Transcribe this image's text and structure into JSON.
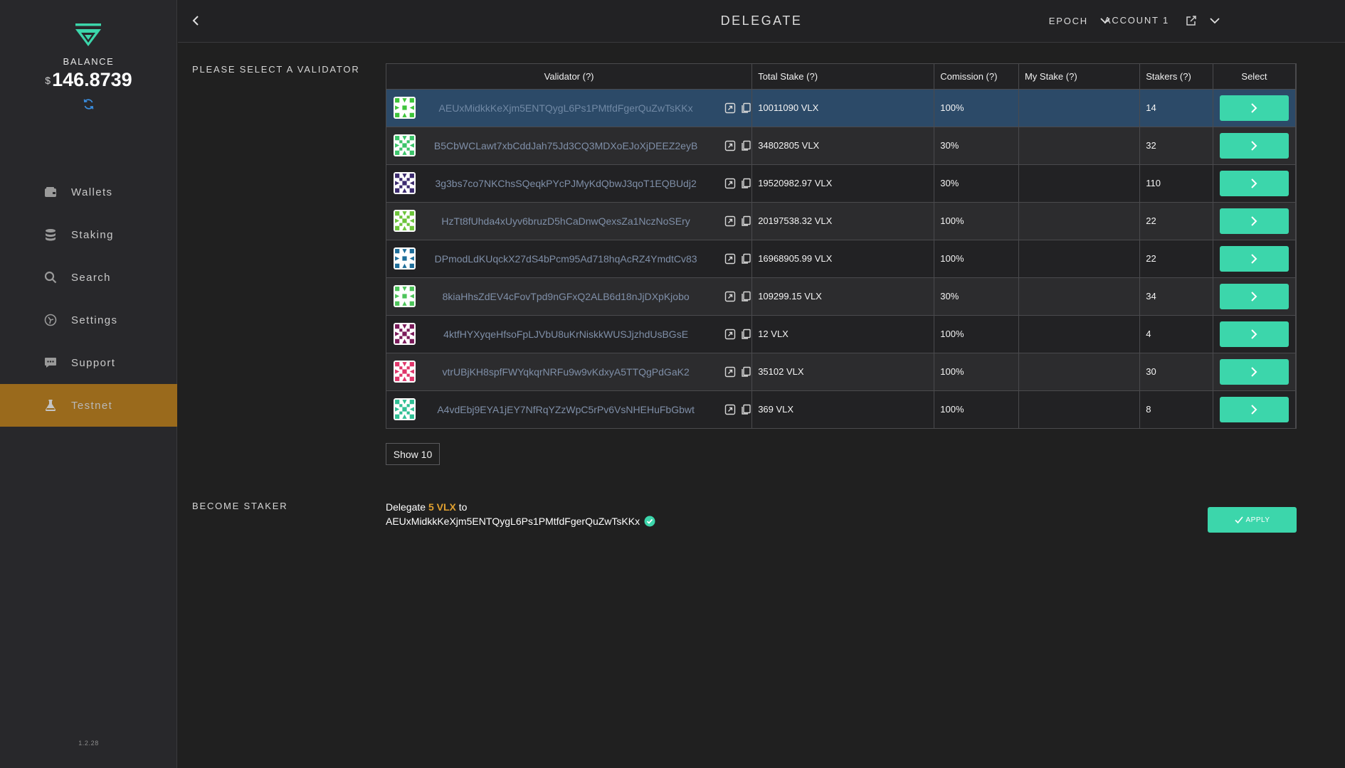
{
  "sidebar": {
    "balance_label": "BALANCE",
    "currency_symbol": "$",
    "balance_value": "146.8739",
    "nav": [
      {
        "label": "Wallets",
        "icon": "wallet-icon"
      },
      {
        "label": "Staking",
        "icon": "database-icon"
      },
      {
        "label": "Search",
        "icon": "search-icon"
      },
      {
        "label": "Settings",
        "icon": "settings-icon"
      },
      {
        "label": "Support",
        "icon": "chat-icon"
      },
      {
        "label": "Testnet",
        "icon": "flask-icon",
        "active": true
      }
    ],
    "version": "1.2.28"
  },
  "header": {
    "title": "DELEGATE",
    "epoch_label": "EPOCH",
    "account_label": "ACCOUNT 1"
  },
  "main": {
    "select_label": "PLEASE SELECT A VALIDATOR",
    "columns": [
      "Validator (?)",
      "Total Stake (?)",
      "Comission (?)",
      "My Stake (?)",
      "Stakers (?)",
      "Select"
    ],
    "rows": [
      {
        "address": "AEUxMidkkKeXjm5ENTQygL6Ps1PMtfdFgerQuZwTsKKx",
        "total_stake": "10011090 VLX",
        "commission": "100%",
        "my_stake": "",
        "stakers": "14",
        "icon_color": "#3ec43a",
        "selected": true
      },
      {
        "address": "B5CbWCLawt7xbCddJah75Jd3CQ3MDXoEJoXjDEEZ2eyB",
        "total_stake": "34802805 VLX",
        "commission": "30%",
        "my_stake": "",
        "stakers": "32",
        "icon_color": "#3bc46a"
      },
      {
        "address": "3g3bs7co7NKChsSQeqkPYcPJMyKdQbwJ3qoT1EQBUdj2",
        "total_stake": "19520982.97 VLX",
        "commission": "30%",
        "my_stake": "",
        "stakers": "110",
        "icon_color": "#3b2a6e"
      },
      {
        "address": "HzTt8fUhda4xUyv6bruzD5hCaDnwQexsZa1NczNoSEry",
        "total_stake": "20197538.32 VLX",
        "commission": "100%",
        "my_stake": "",
        "stakers": "22",
        "icon_color": "#6cc43a"
      },
      {
        "address": "DPmodLdKUqckX27dS4bPcm95Ad718hqAcRZ4YmdtCv83",
        "total_stake": "16968905.99 VLX",
        "commission": "100%",
        "my_stake": "",
        "stakers": "22",
        "icon_color": "#1e6e9a"
      },
      {
        "address": "8kiaHhsZdEV4cFovTpd9nGFxQ2ALB6d18nJjDXpKjobo",
        "total_stake": "109299.15 VLX",
        "commission": "30%",
        "my_stake": "",
        "stakers": "34",
        "icon_color": "#4cc45a"
      },
      {
        "address": "4ktfHYXyqeHfsoFpLJVbU8uKrNiskkWUSJjzhdUsBGsE",
        "total_stake": "12 VLX",
        "commission": "100%",
        "my_stake": "",
        "stakers": "4",
        "icon_color": "#7a1a5a"
      },
      {
        "address": "vtrUBjKH8spfFWYqkqrNRFu9w9vKdxyA5TTQgPdGaK2",
        "total_stake": "35102 VLX",
        "commission": "100%",
        "my_stake": "",
        "stakers": "30",
        "icon_color": "#e0356a"
      },
      {
        "address": "A4vdEbj9EYA1jEY7NfRqYZzWpC5rPv6VsNHEHuFbGbwt",
        "total_stake": "369 VLX",
        "commission": "100%",
        "my_stake": "",
        "stakers": "8",
        "icon_color": "#2fbf94"
      }
    ],
    "show_label": "Show 10",
    "become_label": "BECOME STAKER",
    "delegate_prefix": "Delegate",
    "delegate_amount": "5 VLX",
    "delegate_to": "to",
    "delegate_address": "AEUxMidkkKeXjm5ENTQygL6Ps1PMtfdFgerQuZwTsKKx",
    "apply_label": "APPLY"
  },
  "colors": {
    "accent": "#3cd6ab",
    "active_nav": "#9a6a1c",
    "selected_row": "#2c4a68",
    "amount": "#e0a030"
  }
}
